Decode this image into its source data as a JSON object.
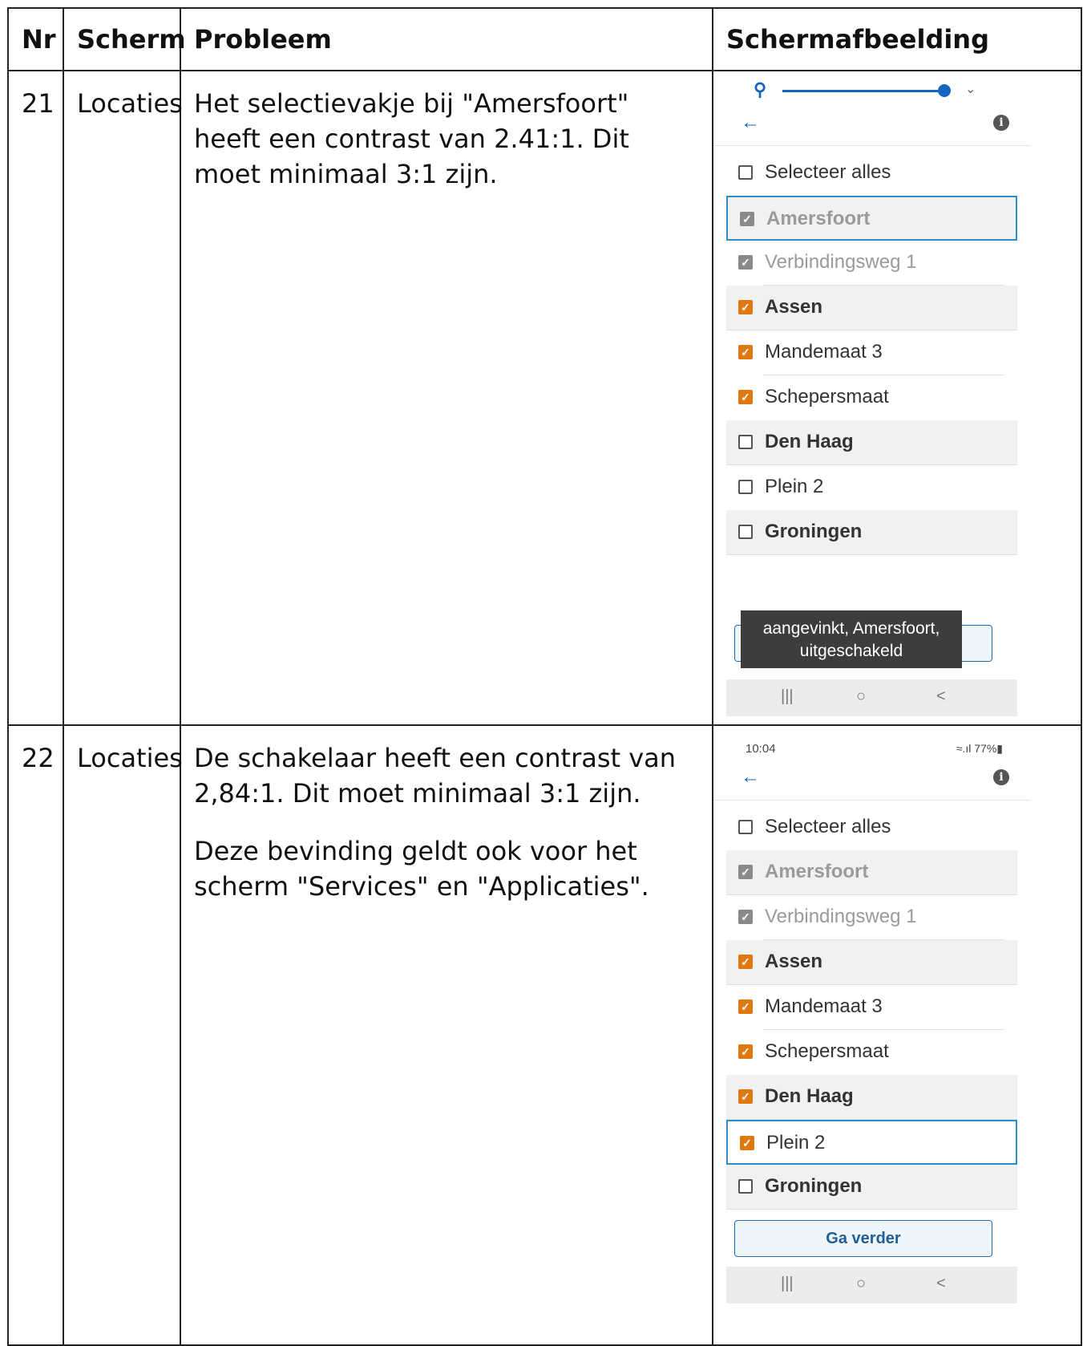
{
  "headers": {
    "nr": "Nr",
    "screen": "Scherm",
    "problem": "Probleem",
    "screenshot": "Schermafbeelding"
  },
  "rows": [
    {
      "nr": "21",
      "screen": "Locaties",
      "problem": [
        "Het selectievakje bij \"Amersfoort\" heeft een contrast van 2.41:1. Dit moet minimaal 3:1 zijn."
      ],
      "phone": {
        "select_all": "Selecteer alles",
        "items": [
          {
            "label": "Amersfoort",
            "checked": true
          },
          {
            "label": "Verbindingsweg 1",
            "checked": true
          },
          {
            "label": "Assen",
            "checked": true
          },
          {
            "label": "Mandemaat 3",
            "checked": true
          },
          {
            "label": "Schepersmaat",
            "checked": true
          },
          {
            "label": "Den Haag",
            "checked": false
          },
          {
            "label": "Plein 2",
            "checked": false
          },
          {
            "label": "Groningen",
            "checked": false
          }
        ],
        "toast": "aangevinkt, Amersfoort, uitgeschakeld"
      }
    },
    {
      "nr": "22",
      "screen": "Locaties",
      "problem": [
        "De schakelaar heeft een contrast van 2,84:1. Dit moet minimaal 3:1 zijn.",
        "Deze bevinding geldt ook voor het scherm \"Services\" en \"Applicaties\"."
      ],
      "phone": {
        "time": "10:04",
        "status_icons": "≈.ıl 77%▮",
        "select_all": "Selecteer alles",
        "items": [
          {
            "label": "Amersfoort",
            "checked": true
          },
          {
            "label": "Verbindingsweg 1",
            "checked": true
          },
          {
            "label": "Assen",
            "checked": true
          },
          {
            "label": "Mandemaat 3",
            "checked": true
          },
          {
            "label": "Schepersmaat",
            "checked": true
          },
          {
            "label": "Den Haag",
            "checked": true
          },
          {
            "label": "Plein 2",
            "checked": true
          },
          {
            "label": "Groningen",
            "checked": false
          }
        ],
        "button": "Ga verder"
      }
    }
  ],
  "icons": {
    "back": "arrow-left-icon",
    "info": "info-icon",
    "accessibility": "accessibility-icon",
    "nav_recent": "|||",
    "nav_home": "○",
    "nav_back": "<"
  },
  "colors": {
    "checked": "#e07810",
    "disabled": "#8a8a8a",
    "focus": "#2a8fc8",
    "link": "#1565c0"
  }
}
